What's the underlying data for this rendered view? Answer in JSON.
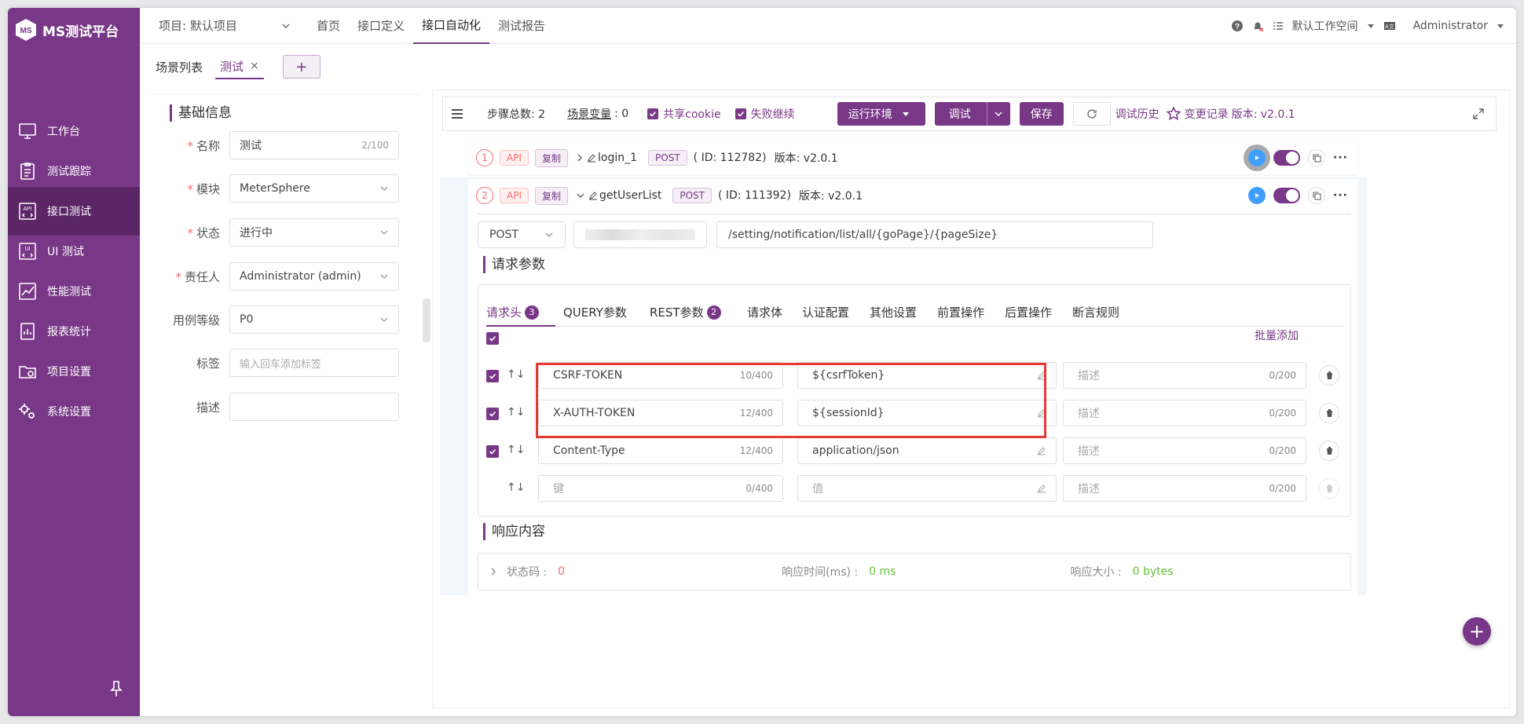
{
  "app": {
    "logo_text": "MS测试平台"
  },
  "sidebar": {
    "items": [
      {
        "label": "工作台",
        "icon": "monitor-icon"
      },
      {
        "label": "测试跟踪",
        "icon": "clipboard-icon"
      },
      {
        "label": "接口测试",
        "icon": "api-icon"
      },
      {
        "label": "UI 测试",
        "icon": "ui-icon"
      },
      {
        "label": "性能测试",
        "icon": "chart-icon"
      },
      {
        "label": "报表统计",
        "icon": "report-icon"
      },
      {
        "label": "项目设置",
        "icon": "folder-gear-icon"
      },
      {
        "label": "系统设置",
        "icon": "gears-icon"
      }
    ]
  },
  "header": {
    "project": "项目: 默认项目",
    "nav": [
      "首页",
      "接口定义",
      "接口自动化",
      "测试报告"
    ],
    "workspace": "默认工作空间",
    "user": "Administrator"
  },
  "tabs": {
    "list_label": "场景列表",
    "current": "测试",
    "close": "×",
    "add": "+"
  },
  "basic": {
    "title": "基础信息",
    "name_label": "名称",
    "name_value": "测试",
    "name_count": "2/100",
    "module_label": "模块",
    "module_value": "MeterSphere",
    "status_label": "状态",
    "status_value": "进行中",
    "owner_label": "责任人",
    "owner_value": "Administrator (admin)",
    "level_label": "用例等级",
    "level_value": "P0",
    "tag_label": "标签",
    "tag_placeholder": "输入回车添加标签",
    "desc_label": "描述"
  },
  "toolbar": {
    "steps": "步骤总数:  2",
    "vars": "场景变量",
    "vars_count": ":  0",
    "share_cookie": "共享cookie",
    "fail_continue": "失败继续",
    "env": "运行环境",
    "debug": "调试",
    "save": "保存",
    "history": "调试历史",
    "changes": "变更记录",
    "version": "版本: v2.0.1"
  },
  "steps": [
    {
      "num": "1",
      "api": "API",
      "copy": "复制",
      "name": "login_1",
      "method": "POST",
      "id": "( ID: 112782)",
      "version": "版本: v2.0.1"
    },
    {
      "num": "2",
      "api": "API",
      "copy": "复制",
      "name": "getUserList",
      "method": "POST",
      "id": "( ID: 111392)",
      "version": "版本: v2.0.1"
    }
  ],
  "request": {
    "method": "POST",
    "url": "/setting/notification/list/all/{goPage}/{pageSize}",
    "params_title": "请求参数",
    "tabs": [
      {
        "label": "请求头",
        "badge": "3"
      },
      {
        "label": "QUERY参数"
      },
      {
        "label": "REST参数",
        "badge": "2"
      },
      {
        "label": "请求体"
      },
      {
        "label": "认证配置"
      },
      {
        "label": "其他设置"
      },
      {
        "label": "前置操作"
      },
      {
        "label": "后置操作"
      },
      {
        "label": "断言规则"
      }
    ],
    "batch_add": "批量添加",
    "headers": [
      {
        "key": "CSRF-TOKEN",
        "key_count": "10/400",
        "value": "${csrfToken}",
        "desc": "描述",
        "desc_count": "0/200"
      },
      {
        "key": "X-AUTH-TOKEN",
        "key_count": "12/400",
        "value": "${sessionId}",
        "desc": "描述",
        "desc_count": "0/200"
      },
      {
        "key": "Content-Type",
        "key_count": "12/400",
        "value": "application/json",
        "desc": "描述",
        "desc_count": "0/200"
      }
    ],
    "empty_row": {
      "key_ph": "键",
      "key_count": "0/400",
      "value_ph": "值",
      "desc_ph": "描述",
      "desc_count": "0/200"
    },
    "arrows": "↑↓"
  },
  "response": {
    "title": "响应内容",
    "status_label": "状态码 :",
    "status_value": "0",
    "time_label": "响应时间(ms) :",
    "time_value": "0 ms",
    "size_label": "响应大小 :",
    "size_value": "0 bytes"
  },
  "colors": {
    "brand": "#783887",
    "danger": "#f56c6c",
    "success": "#67c23a",
    "highlight": "#e53935"
  }
}
